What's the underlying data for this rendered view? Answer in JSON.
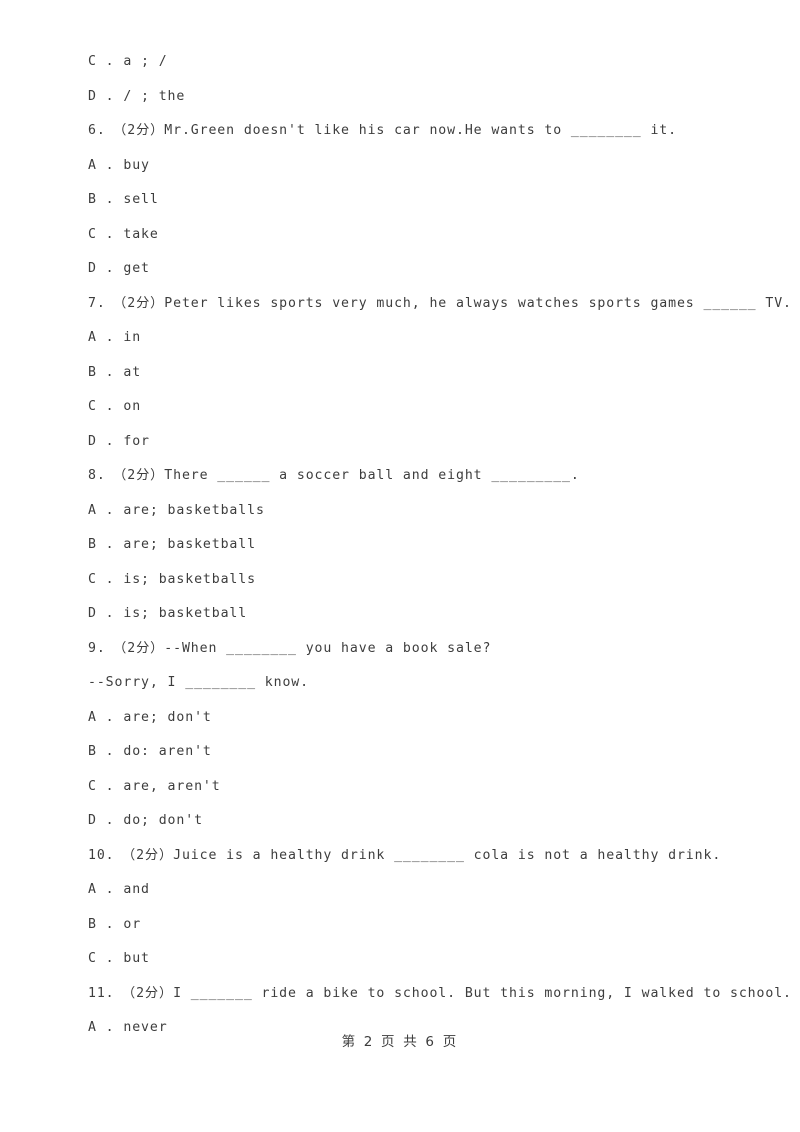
{
  "document": {
    "page_background": "#ffffff",
    "text_color": "#3d3d3d",
    "footer": "第 2 页 共 6 页"
  },
  "lines": [
    {
      "id": "opt-5c",
      "kind": "option",
      "text": "C . a ; /"
    },
    {
      "id": "opt-5d",
      "kind": "option",
      "text": "D . / ; the"
    },
    {
      "id": "q6-stem",
      "kind": "question",
      "number": "6.",
      "marks": "（2分）",
      "text": "6.　（2分）Mr.Green doesn't like his car now.He wants to ________ it."
    },
    {
      "id": "q6-a",
      "kind": "option",
      "text": "A . buy"
    },
    {
      "id": "q6-b",
      "kind": "option",
      "text": "B . sell"
    },
    {
      "id": "q6-c",
      "kind": "option",
      "text": "C . take"
    },
    {
      "id": "q6-d",
      "kind": "option",
      "text": "D . get"
    },
    {
      "id": "q7-stem",
      "kind": "question",
      "number": "7.",
      "marks": "（2分）",
      "text": "7.　（2分）Peter likes sports very much, he always watches sports games ______ TV."
    },
    {
      "id": "q7-a",
      "kind": "option",
      "text": "A . in"
    },
    {
      "id": "q7-b",
      "kind": "option",
      "text": "B . at"
    },
    {
      "id": "q7-c",
      "kind": "option",
      "text": "C . on"
    },
    {
      "id": "q7-d",
      "kind": "option",
      "text": "D . for"
    },
    {
      "id": "q8-stem",
      "kind": "question",
      "number": "8.",
      "marks": "（2分）",
      "text": "8.　（2分）There ______ a soccer ball and eight _________."
    },
    {
      "id": "q8-a",
      "kind": "option",
      "text": "A . are; basketballs"
    },
    {
      "id": "q8-b",
      "kind": "option",
      "text": "B . are; basketball"
    },
    {
      "id": "q8-c",
      "kind": "option",
      "text": "C . is; basketballs"
    },
    {
      "id": "q8-d",
      "kind": "option",
      "text": "D . is; basketball"
    },
    {
      "id": "q9-stem",
      "kind": "question",
      "number": "9.",
      "marks": "（2分）",
      "text": "9.　（2分）--When ________ you have a book sale?"
    },
    {
      "id": "q9-stem2",
      "kind": "question-cont",
      "text": "--Sorry, I ________ know."
    },
    {
      "id": "q9-a",
      "kind": "option",
      "text": "A . are; don't"
    },
    {
      "id": "q9-b",
      "kind": "option",
      "text": "B . do: aren't"
    },
    {
      "id": "q9-c",
      "kind": "option",
      "text": "C . are, aren't"
    },
    {
      "id": "q9-d",
      "kind": "option",
      "text": "D . do; don't"
    },
    {
      "id": "q10-stem",
      "kind": "question",
      "number": "10.",
      "marks": "（2分）",
      "text": "10.　（2分）Juice is a healthy drink ________ cola is not a healthy drink."
    },
    {
      "id": "q10-a",
      "kind": "option",
      "text": "A . and"
    },
    {
      "id": "q10-b",
      "kind": "option",
      "text": "B . or"
    },
    {
      "id": "q10-c",
      "kind": "option",
      "text": "C . but"
    },
    {
      "id": "q11-stem",
      "kind": "question",
      "number": "11.",
      "marks": "（2分）",
      "text": "11.　（2分）I _______ ride a bike to school. But this morning, I walked to school."
    },
    {
      "id": "q11-a",
      "kind": "option",
      "text": "A . never"
    }
  ]
}
